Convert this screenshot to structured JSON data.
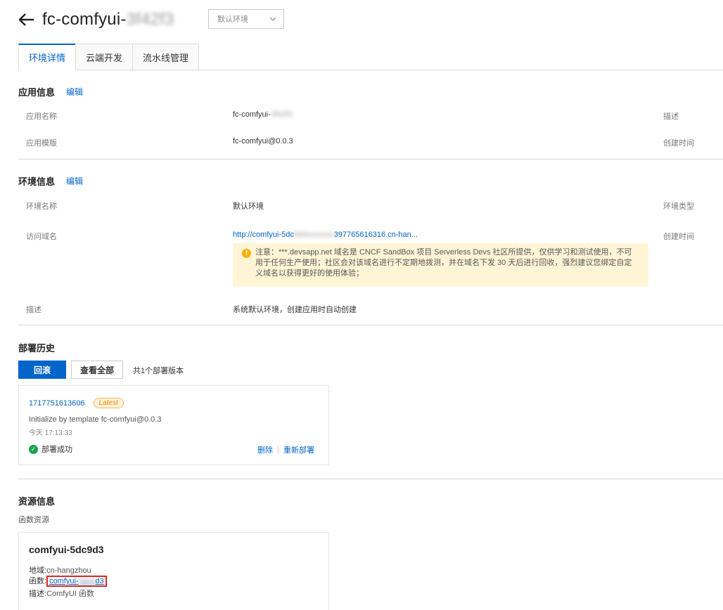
{
  "header": {
    "title_prefix": "fc-comfyui-",
    "title_suffix_blurred": "3f42f3",
    "env_select_value": "默认环境"
  },
  "tabs": [
    {
      "label": "环境详情",
      "active": true
    },
    {
      "label": "云端开发",
      "active": false
    },
    {
      "label": "流水线管理",
      "active": false
    }
  ],
  "app_info": {
    "title": "应用信息",
    "edit": "编辑",
    "name_label": "应用名称",
    "name_value": "fc-comfyui-",
    "name_blurred": "3f42f3",
    "template_label": "应用模版",
    "template_value": "fc-comfyui@0.0.3",
    "desc_label": "描述",
    "created_label": "创建时间"
  },
  "env_info": {
    "title": "环境信息",
    "edit": "编辑",
    "env_name_label": "环境名称",
    "env_name_value": "默认环境",
    "env_type_label": "环境类型",
    "domain_label": "访问域名",
    "domain_prefix": "http://comfyui-5dc",
    "domain_blurred": "9d3xxxxxxx",
    "domain_suffix": "397765616316.cn-han...",
    "created_label": "创建时间",
    "notice": "注意：***.devsapp.net 域名是 CNCF SandBox 项目 Serverless Devs 社区所提供，仅供学习和测试使用，不可用于任何生产使用；社区会对该域名进行不定期地拨测，并在域名下发 30 天后进行回收，强烈建议您绑定自定义域名以获得更好的使用体验；",
    "desc_label": "描述",
    "desc_value": "系统默认环境，创建应用时自动创建"
  },
  "deploy": {
    "title": "部署历史",
    "rollback": "回滚",
    "view_all": "查看全部",
    "count_text": "共1个部署版本",
    "card": {
      "version": "1717751613606",
      "badge": "Latest",
      "message": "Initialize by template fc-comfyui@0.0.3",
      "time": "今天 17:13:33",
      "status": "部署成功",
      "delete": "删除",
      "redeploy": "重新部署"
    }
  },
  "resources": {
    "title": "资源信息",
    "subtitle": "函数资源",
    "card": {
      "name": "comfyui-5dc9d3",
      "region_label": "地域:",
      "region_value": "cn-hangzhou",
      "func_label": "函数:",
      "func_prefix": "comfyui-",
      "func_blurred": "5dc9",
      "func_suffix": "d3",
      "desc_label": "描述:",
      "desc_value": "ComfyUI 函数"
    }
  },
  "colors": {
    "primary": "#0064c8",
    "success": "#1aa34a",
    "warning": "#f5b100",
    "notice_bg": "#fff5d6",
    "highlight_border": "#e02424"
  }
}
